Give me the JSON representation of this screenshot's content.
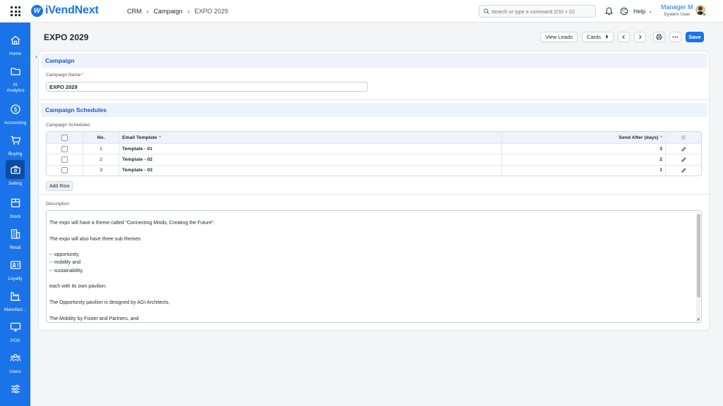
{
  "app": {
    "logo_text": "iVendNext"
  },
  "breadcrumb": [
    "CRM",
    "Campaign",
    "EXPO 2029"
  ],
  "search": {
    "placeholder": "Search or type a command (Ctrl + G)"
  },
  "header": {
    "help_label": "Help",
    "user_name": "Manager M",
    "user_role": "System User"
  },
  "sidebar": {
    "items": [
      {
        "label": "Home",
        "icon": "home-icon"
      },
      {
        "label": "AI Analytics",
        "icon": "folder-icon"
      },
      {
        "label": "Accounting",
        "icon": "dollar-icon"
      },
      {
        "label": "Buying",
        "icon": "cart-icon"
      },
      {
        "label": "Selling",
        "icon": "briefcase-icon"
      },
      {
        "label": "Stock",
        "icon": "box-icon"
      },
      {
        "label": "Retail",
        "icon": "building-icon"
      },
      {
        "label": "Loyalty",
        "icon": "id-card-icon"
      },
      {
        "label": "Manufact...",
        "icon": "factory-icon"
      },
      {
        "label": "POS",
        "icon": "monitor-icon"
      },
      {
        "label": "Users",
        "icon": "users-icon"
      },
      {
        "label": "",
        "icon": "sliders-icon"
      }
    ],
    "active_index": 4
  },
  "page": {
    "title": "EXPO 2029",
    "actions": {
      "view_leads": "View Leads",
      "view_mode": "Cards",
      "save": "Save"
    }
  },
  "campaign_section": {
    "title": "Campaign",
    "name_label": "Campaign Name",
    "name_value": "EXPO 2029"
  },
  "schedules_section": {
    "title": "Campaign Schedules",
    "table_label": "Campaign Schedules",
    "columns": {
      "no": "No.",
      "email_template": "Email Template",
      "send_after": "Send After (days)"
    },
    "rows": [
      {
        "no": "1",
        "email_template": "Template - 01",
        "send_after": "3"
      },
      {
        "no": "2",
        "email_template": "Template - 02",
        "send_after": "2"
      },
      {
        "no": "3",
        "email_template": "Template - 03",
        "send_after": "1"
      }
    ],
    "add_row_label": "Add Row"
  },
  "description": {
    "label": "Description",
    "lines": [
      "The expo will have a theme called \"Connecting Minds, Creating the Future\".",
      "",
      "The expo will also have three sub themes:",
      "",
      "-- opportunity,",
      "-- mobility and",
      "-- sustainability,",
      "",
      "each with its own pavilion.",
      "",
      "The Opportunity pavilion is designed by AGI Architects,",
      "",
      "The Mobility by Foster and Partners, and"
    ]
  },
  "colors": {
    "primary": "#1a73e8",
    "sidebar_active": "#0c4da3",
    "section_header_bg": "#edf2fb",
    "required": "#e24c4c"
  }
}
